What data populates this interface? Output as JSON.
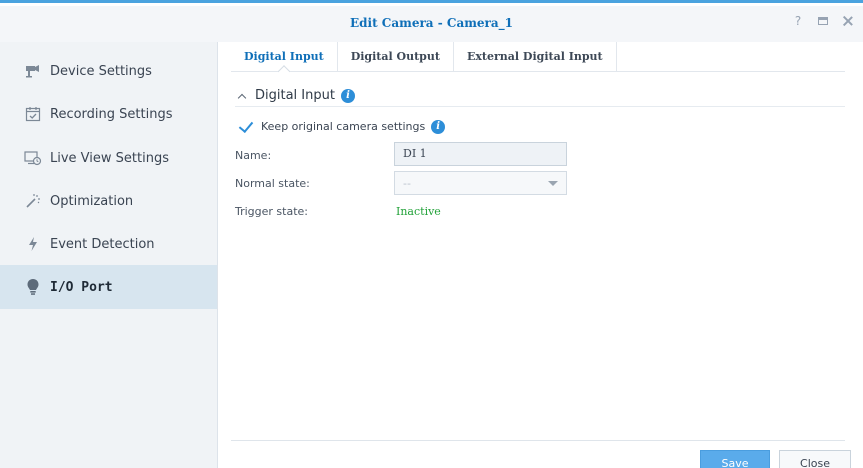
{
  "window": {
    "title": "Edit Camera - Camera_1",
    "accent_color": "#4aa3df",
    "controls": {
      "help": "?",
      "maximize": "maximize-icon",
      "close": "close-icon"
    }
  },
  "sidebar": {
    "items": [
      {
        "label": "Device Settings",
        "icon": "camera-icon",
        "active": false
      },
      {
        "label": "Recording Settings",
        "icon": "calendar-check-icon",
        "active": false
      },
      {
        "label": "Live View Settings",
        "icon": "monitor-clock-icon",
        "active": false
      },
      {
        "label": "Optimization",
        "icon": "magic-wand-icon",
        "active": false
      },
      {
        "label": "Event Detection",
        "icon": "lightning-icon",
        "active": false
      },
      {
        "label": "I/O Port",
        "icon": "lightbulb-icon",
        "active": true
      }
    ]
  },
  "tabs": [
    {
      "label": "Digital Input",
      "active": true
    },
    {
      "label": "Digital Output",
      "active": false
    },
    {
      "label": "External Digital Input",
      "active": false
    }
  ],
  "section": {
    "title": "Digital Input",
    "keep_original_label": "Keep original camera settings",
    "keep_original_checked": true
  },
  "form": {
    "name_label": "Name:",
    "name_value": "DI 1",
    "normal_state_label": "Normal state:",
    "normal_state_value": "--",
    "trigger_state_label": "Trigger state:",
    "trigger_state_value": "Inactive",
    "trigger_state_color": "#23a23a"
  },
  "footer": {
    "save_label": "Save",
    "close_label": "Close"
  }
}
